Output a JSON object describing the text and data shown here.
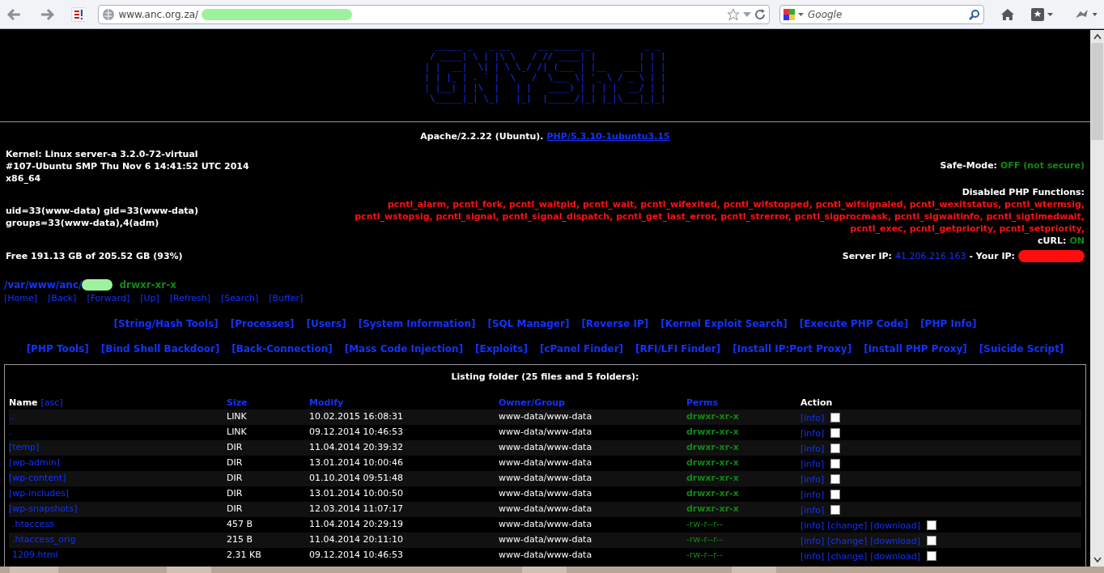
{
  "browser": {
    "url": "www.anc.org.za/",
    "search_placeholder": "Google"
  },
  "logo": "  _____ _   _ __     __ _____ _          _ _ \n / ____| \\ | |\\ \\   / // ____| |        | | |\n| |  __|  \\| | \\ \\_/ /| (___ | |__   ___| | |\n| | |_ | . ` |  \\   /  \\___ \\| '_ \\ / _ \\ | |\n| |__| | |\\  |   | |   ____) | | | |  __/ | |\n \\_____|_| \\_|   |_|  |_____/|_| |_|\\___|_|_|",
  "server_line": {
    "text": "Apache/2.2.22 (Ubuntu).",
    "php_link": "PHP/5.3.10-1ubuntu3.15"
  },
  "kernel_lines": [
    "Kernel: Linux server-a 3.2.0-72-virtual",
    "#107-Ubuntu SMP Thu Nov 6 14:41:52 UTC 2014",
    "x86_64"
  ],
  "safe_mode": {
    "label": "Safe-Mode:",
    "value": "OFF (not secure)"
  },
  "uid_lines": [
    "uid=33(www-data) gid=33(www-data)",
    "groups=33(www-data),4(adm)"
  ],
  "disabled_functions": {
    "heading": "Disabled PHP Functions:",
    "lines": [
      "pcntl_alarm, pcntl_fork, pcntl_waitpid, pcntl_wait, pcntl_wifexited, pcntl_wifstopped, pcntl_wifsignaled, pcntl_wexitstatus, pcntl_wtermsig,",
      "pcntl_wstopsig, pcntl_signal, pcntl_signal_dispatch, pcntl_get_last_error, pcntl_strerror, pcntl_sigprocmask, pcntl_sigwaitinfo, pcntl_sigtimedwait,",
      "pcntl_exec, pcntl_getpriority, pcntl_setpriority,"
    ]
  },
  "curl": {
    "label": "cURL:",
    "value": "ON"
  },
  "free_space": "Free 191.13 GB of 205.52 GB (93%)",
  "server_ip": {
    "label": "Server IP:",
    "ip": "41.206.216.163",
    "separator": "- Your IP:"
  },
  "path": {
    "text": "/var/www/anc/",
    "perms": "drwxr-xr-x"
  },
  "nav": [
    "[Home]",
    "[Back]",
    "[Forward]",
    "[Up]",
    "[Refresh]",
    "[Search]",
    "[Buffer]"
  ],
  "tools_row_1": [
    "[String/Hash Tools]",
    "[Processes]",
    "[Users]",
    "[System Information]",
    "[SQL Manager]",
    "[Reverse IP]",
    "[Kernel Exploit Search]",
    "[Execute PHP Code]",
    "[PHP Info]"
  ],
  "tools_row_2": [
    "[PHP Tools]",
    "[Bind Shell Backdoor]",
    "[Back-Connection]",
    "[Mass Code Injection]",
    "[Exploits]",
    "[cPanel Finder]",
    "[RFI/LFI Finder]",
    "[Install IP:Port Proxy]",
    "[Install PHP Proxy]",
    "[Suicide Script]"
  ],
  "listing": {
    "title": "Listing folder (25 files and 5 folders):",
    "columns": [
      {
        "label": "Name",
        "sort": "[asc]",
        "kind": "plain"
      },
      {
        "label": "Size",
        "kind": "link"
      },
      {
        "label": "Modify",
        "kind": "link"
      },
      {
        "label": "Owner/Group",
        "kind": "link"
      },
      {
        "label": "Perms",
        "kind": "link"
      },
      {
        "label": "Action",
        "kind": "plain"
      }
    ],
    "rows": [
      {
        "kind": "dir",
        "name": "..",
        "size": "LINK",
        "modify": "10.02.2015 16:08:31",
        "owner": "www-data/www-data",
        "perms": "drwxr-xr-x",
        "actions": [
          "[info]"
        ],
        "checked": false
      },
      {
        "kind": "dir",
        "name": ".",
        "size": "LINK",
        "modify": "09.12.2014 10:46:53",
        "owner": "www-data/www-data",
        "perms": "drwxr-xr-x",
        "actions": [
          "[info]"
        ],
        "checked": false
      },
      {
        "kind": "dir",
        "name": "[temp]",
        "size": "DIR",
        "modify": "11.04.2014 20:39:32",
        "owner": "www-data/www-data",
        "perms": "drwxr-xr-x",
        "actions": [
          "[info]"
        ],
        "checked": false
      },
      {
        "kind": "dir",
        "name": "[wp-admin]",
        "size": "DIR",
        "modify": "13.01.2014 10:00:46",
        "owner": "www-data/www-data",
        "perms": "drwxr-xr-x",
        "actions": [
          "[info]"
        ],
        "checked": false
      },
      {
        "kind": "dir",
        "name": "[wp-content]",
        "size": "DIR",
        "modify": "01.10.2014 09:51:48",
        "owner": "www-data/www-data",
        "perms": "drwxr-xr-x",
        "actions": [
          "[info]"
        ],
        "checked": false
      },
      {
        "kind": "dir",
        "name": "[wp-includes]",
        "size": "DIR",
        "modify": "13.01.2014 10:00:50",
        "owner": "www-data/www-data",
        "perms": "drwxr-xr-x",
        "actions": [
          "[info]"
        ],
        "checked": false
      },
      {
        "kind": "dir",
        "name": "[wp-snapshots]",
        "size": "DIR",
        "modify": "12.03.2014 11:07:17",
        "owner": "www-data/www-data",
        "perms": "drwxr-xr-x",
        "actions": [
          "[info]"
        ],
        "checked": false
      },
      {
        "kind": "file",
        "name": ".htaccess",
        "size": "457 B",
        "modify": "11.04.2014 20:29:19",
        "owner": "www-data/www-data",
        "perms": "-rw-r--r--",
        "actions": [
          "[info]",
          "[change]",
          "[download]"
        ],
        "checked": false
      },
      {
        "kind": "file",
        "name": ".htaccess_orig",
        "size": "215 B",
        "modify": "11.04.2014 20:11:10",
        "owner": "www-data/www-data",
        "perms": "-rw-r--r--",
        "actions": [
          "[info]",
          "[change]",
          "[download]"
        ],
        "checked": false
      },
      {
        "kind": "file",
        "name": "1209.html",
        "size": "2.31 KB",
        "modify": "09.12.2014 10:46:53",
        "owner": "www-data/www-data",
        "perms": "-rw-r--r--",
        "actions": [
          "[info]",
          "[change]",
          "[download]"
        ],
        "checked": false
      }
    ]
  }
}
